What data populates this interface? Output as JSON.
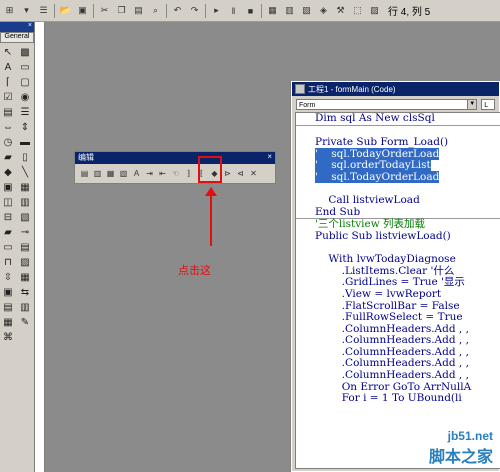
{
  "status": {
    "position": "行 4, 列 5"
  },
  "toolbox": {
    "title": "",
    "section_label": "General"
  },
  "edit_toolbar": {
    "title": "编辑",
    "close": "×"
  },
  "annotation": {
    "label": "点击这"
  },
  "code_window": {
    "title": "工程1 - formMain (Code)",
    "object_combo": "Form",
    "procedure_combo": "L",
    "lines": [
      "Dim sql As New clsSql",
      "",
      "Private Sub Form_Load()",
      "'    sql.TodayOrderLoad",
      "'    sql.orderTodayList",
      "'    sql.TodayOrderLoad",
      "",
      "    Call listviewLoad",
      "End Sub",
      "'三个listview 列表加载",
      "Public Sub listviewLoad()",
      "",
      "    With lvwTodayDiagnose",
      "        .ListItems.Clear '什么",
      "        .GridLines = True '显示",
      "        .View = lvwReport",
      "        .FlatScrollBar = False",
      "        .FullRowSelect = True",
      "        .ColumnHeaders.Add , ,",
      "        .ColumnHeaders.Add , ,",
      "        .ColumnHeaders.Add , ,",
      "        .ColumnHeaders.Add , ,",
      "        .ColumnHeaders.Add , ,",
      "        On Error GoTo ArrNullA",
      "        For i = 1 To UBound(li"
    ]
  },
  "watermark": {
    "site": "jb51.net",
    "brand": "脚本之家"
  }
}
